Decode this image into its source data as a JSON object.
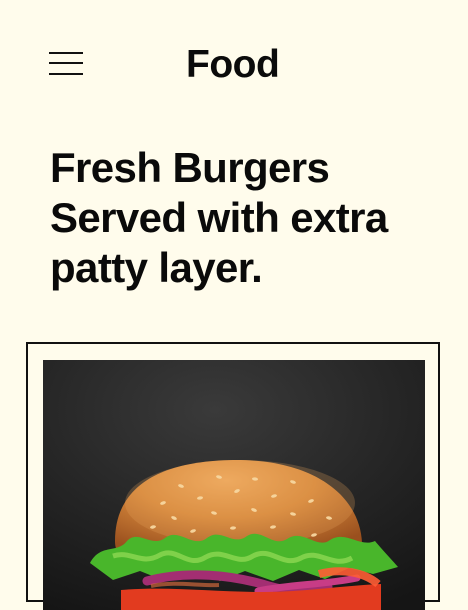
{
  "header": {
    "menu_icon": "hamburger-menu-icon",
    "brand": "Food"
  },
  "hero": {
    "headline": "Fresh Burgers Served with extra patty layer."
  },
  "media": {
    "image": "burger-photo",
    "colors": {
      "background": "#fffcec",
      "photo_backdrop": "#242424",
      "bun": "#d38a3d",
      "lettuce": "#4fbd2d",
      "onion": "#a22f6f",
      "tomato": "#e23b1f"
    }
  }
}
